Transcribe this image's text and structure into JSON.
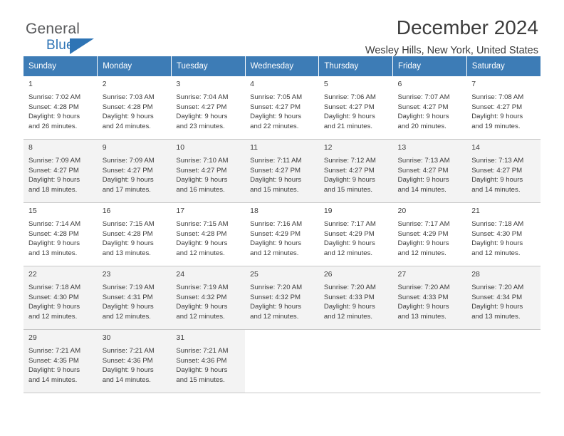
{
  "logo": {
    "word_one": "General",
    "word_two": "Blue",
    "flag_icon": "blue-flag-icon"
  },
  "header": {
    "title": "December 2024",
    "location": "Wesley Hills, New York, United States"
  },
  "colors": {
    "header_blue": "#3d7cb6",
    "logo_blue": "#2e74b5",
    "alt_row": "#f3f3f3",
    "text": "#3c3c3c"
  },
  "calendar": {
    "weekday_headers": [
      "Sunday",
      "Monday",
      "Tuesday",
      "Wednesday",
      "Thursday",
      "Friday",
      "Saturday"
    ],
    "weeks": [
      [
        {
          "day": "1",
          "sunrise": "Sunrise: 7:02 AM",
          "sunset": "Sunset: 4:28 PM",
          "daylight_1": "Daylight: 9 hours",
          "daylight_2": "and 26 minutes."
        },
        {
          "day": "2",
          "sunrise": "Sunrise: 7:03 AM",
          "sunset": "Sunset: 4:28 PM",
          "daylight_1": "Daylight: 9 hours",
          "daylight_2": "and 24 minutes."
        },
        {
          "day": "3",
          "sunrise": "Sunrise: 7:04 AM",
          "sunset": "Sunset: 4:27 PM",
          "daylight_1": "Daylight: 9 hours",
          "daylight_2": "and 23 minutes."
        },
        {
          "day": "4",
          "sunrise": "Sunrise: 7:05 AM",
          "sunset": "Sunset: 4:27 PM",
          "daylight_1": "Daylight: 9 hours",
          "daylight_2": "and 22 minutes."
        },
        {
          "day": "5",
          "sunrise": "Sunrise: 7:06 AM",
          "sunset": "Sunset: 4:27 PM",
          "daylight_1": "Daylight: 9 hours",
          "daylight_2": "and 21 minutes."
        },
        {
          "day": "6",
          "sunrise": "Sunrise: 7:07 AM",
          "sunset": "Sunset: 4:27 PM",
          "daylight_1": "Daylight: 9 hours",
          "daylight_2": "and 20 minutes."
        },
        {
          "day": "7",
          "sunrise": "Sunrise: 7:08 AM",
          "sunset": "Sunset: 4:27 PM",
          "daylight_1": "Daylight: 9 hours",
          "daylight_2": "and 19 minutes."
        }
      ],
      [
        {
          "day": "8",
          "sunrise": "Sunrise: 7:09 AM",
          "sunset": "Sunset: 4:27 PM",
          "daylight_1": "Daylight: 9 hours",
          "daylight_2": "and 18 minutes."
        },
        {
          "day": "9",
          "sunrise": "Sunrise: 7:09 AM",
          "sunset": "Sunset: 4:27 PM",
          "daylight_1": "Daylight: 9 hours",
          "daylight_2": "and 17 minutes."
        },
        {
          "day": "10",
          "sunrise": "Sunrise: 7:10 AM",
          "sunset": "Sunset: 4:27 PM",
          "daylight_1": "Daylight: 9 hours",
          "daylight_2": "and 16 minutes."
        },
        {
          "day": "11",
          "sunrise": "Sunrise: 7:11 AM",
          "sunset": "Sunset: 4:27 PM",
          "daylight_1": "Daylight: 9 hours",
          "daylight_2": "and 15 minutes."
        },
        {
          "day": "12",
          "sunrise": "Sunrise: 7:12 AM",
          "sunset": "Sunset: 4:27 PM",
          "daylight_1": "Daylight: 9 hours",
          "daylight_2": "and 15 minutes."
        },
        {
          "day": "13",
          "sunrise": "Sunrise: 7:13 AM",
          "sunset": "Sunset: 4:27 PM",
          "daylight_1": "Daylight: 9 hours",
          "daylight_2": "and 14 minutes."
        },
        {
          "day": "14",
          "sunrise": "Sunrise: 7:13 AM",
          "sunset": "Sunset: 4:27 PM",
          "daylight_1": "Daylight: 9 hours",
          "daylight_2": "and 14 minutes."
        }
      ],
      [
        {
          "day": "15",
          "sunrise": "Sunrise: 7:14 AM",
          "sunset": "Sunset: 4:28 PM",
          "daylight_1": "Daylight: 9 hours",
          "daylight_2": "and 13 minutes."
        },
        {
          "day": "16",
          "sunrise": "Sunrise: 7:15 AM",
          "sunset": "Sunset: 4:28 PM",
          "daylight_1": "Daylight: 9 hours",
          "daylight_2": "and 13 minutes."
        },
        {
          "day": "17",
          "sunrise": "Sunrise: 7:15 AM",
          "sunset": "Sunset: 4:28 PM",
          "daylight_1": "Daylight: 9 hours",
          "daylight_2": "and 12 minutes."
        },
        {
          "day": "18",
          "sunrise": "Sunrise: 7:16 AM",
          "sunset": "Sunset: 4:29 PM",
          "daylight_1": "Daylight: 9 hours",
          "daylight_2": "and 12 minutes."
        },
        {
          "day": "19",
          "sunrise": "Sunrise: 7:17 AM",
          "sunset": "Sunset: 4:29 PM",
          "daylight_1": "Daylight: 9 hours",
          "daylight_2": "and 12 minutes."
        },
        {
          "day": "20",
          "sunrise": "Sunrise: 7:17 AM",
          "sunset": "Sunset: 4:29 PM",
          "daylight_1": "Daylight: 9 hours",
          "daylight_2": "and 12 minutes."
        },
        {
          "day": "21",
          "sunrise": "Sunrise: 7:18 AM",
          "sunset": "Sunset: 4:30 PM",
          "daylight_1": "Daylight: 9 hours",
          "daylight_2": "and 12 minutes."
        }
      ],
      [
        {
          "day": "22",
          "sunrise": "Sunrise: 7:18 AM",
          "sunset": "Sunset: 4:30 PM",
          "daylight_1": "Daylight: 9 hours",
          "daylight_2": "and 12 minutes."
        },
        {
          "day": "23",
          "sunrise": "Sunrise: 7:19 AM",
          "sunset": "Sunset: 4:31 PM",
          "daylight_1": "Daylight: 9 hours",
          "daylight_2": "and 12 minutes."
        },
        {
          "day": "24",
          "sunrise": "Sunrise: 7:19 AM",
          "sunset": "Sunset: 4:32 PM",
          "daylight_1": "Daylight: 9 hours",
          "daylight_2": "and 12 minutes."
        },
        {
          "day": "25",
          "sunrise": "Sunrise: 7:20 AM",
          "sunset": "Sunset: 4:32 PM",
          "daylight_1": "Daylight: 9 hours",
          "daylight_2": "and 12 minutes."
        },
        {
          "day": "26",
          "sunrise": "Sunrise: 7:20 AM",
          "sunset": "Sunset: 4:33 PM",
          "daylight_1": "Daylight: 9 hours",
          "daylight_2": "and 12 minutes."
        },
        {
          "day": "27",
          "sunrise": "Sunrise: 7:20 AM",
          "sunset": "Sunset: 4:33 PM",
          "daylight_1": "Daylight: 9 hours",
          "daylight_2": "and 13 minutes."
        },
        {
          "day": "28",
          "sunrise": "Sunrise: 7:20 AM",
          "sunset": "Sunset: 4:34 PM",
          "daylight_1": "Daylight: 9 hours",
          "daylight_2": "and 13 minutes."
        }
      ],
      [
        {
          "day": "29",
          "sunrise": "Sunrise: 7:21 AM",
          "sunset": "Sunset: 4:35 PM",
          "daylight_1": "Daylight: 9 hours",
          "daylight_2": "and 14 minutes."
        },
        {
          "day": "30",
          "sunrise": "Sunrise: 7:21 AM",
          "sunset": "Sunset: 4:36 PM",
          "daylight_1": "Daylight: 9 hours",
          "daylight_2": "and 14 minutes."
        },
        {
          "day": "31",
          "sunrise": "Sunrise: 7:21 AM",
          "sunset": "Sunset: 4:36 PM",
          "daylight_1": "Daylight: 9 hours",
          "daylight_2": "and 15 minutes."
        },
        {
          "day": "",
          "sunrise": "",
          "sunset": "",
          "daylight_1": "",
          "daylight_2": ""
        },
        {
          "day": "",
          "sunrise": "",
          "sunset": "",
          "daylight_1": "",
          "daylight_2": ""
        },
        {
          "day": "",
          "sunrise": "",
          "sunset": "",
          "daylight_1": "",
          "daylight_2": ""
        },
        {
          "day": "",
          "sunrise": "",
          "sunset": "",
          "daylight_1": "",
          "daylight_2": ""
        }
      ]
    ]
  }
}
